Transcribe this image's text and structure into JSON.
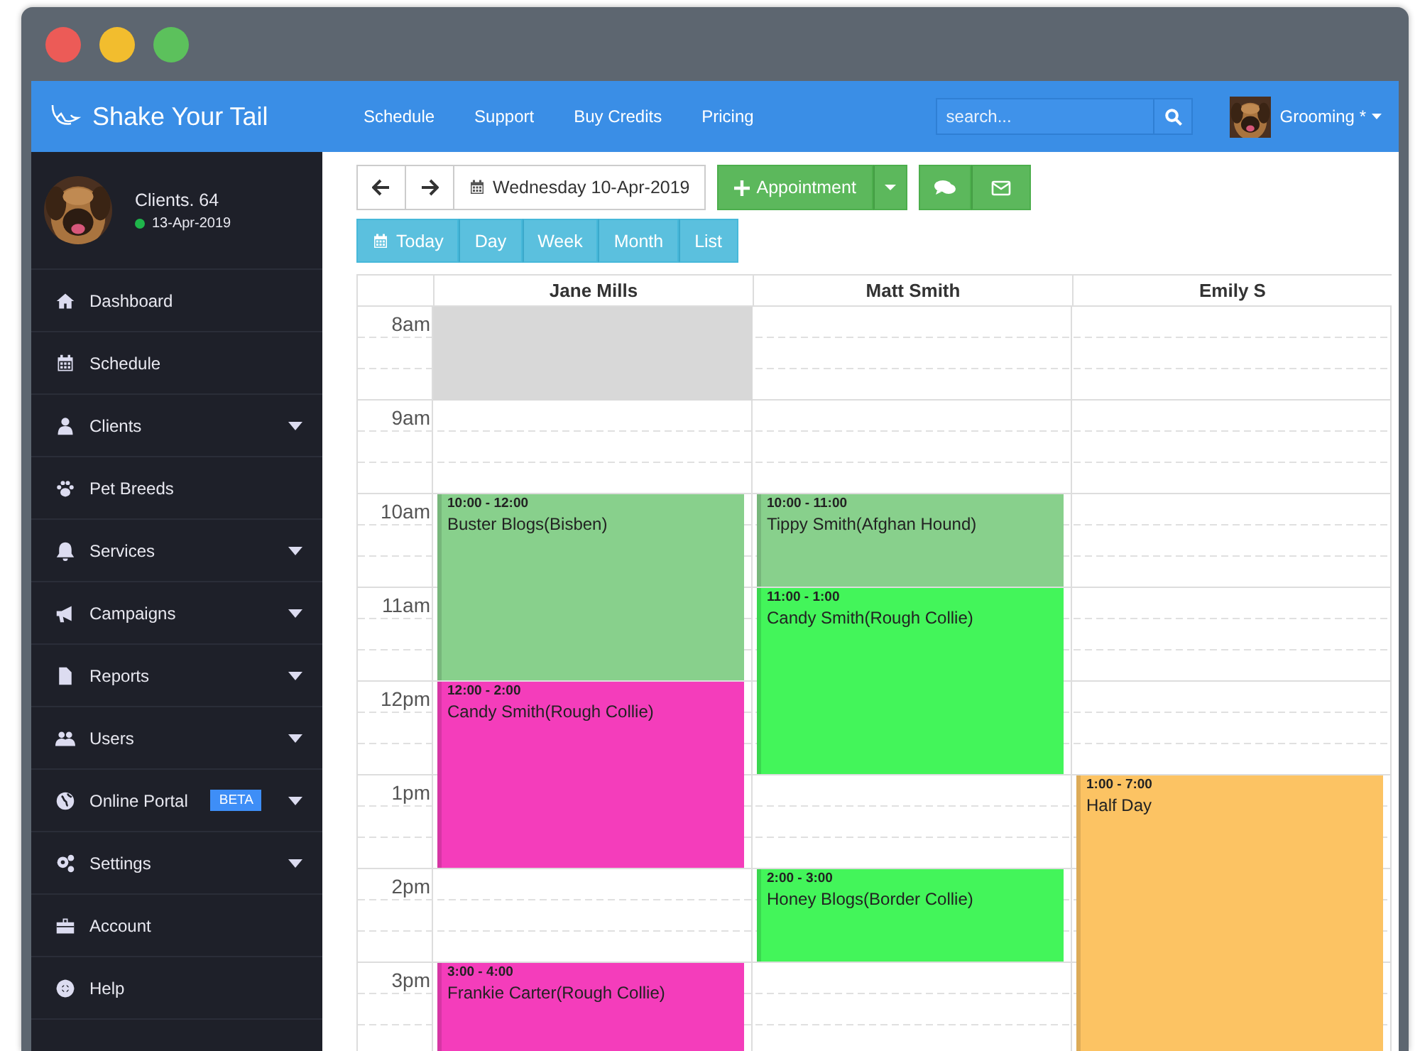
{
  "topbar": {
    "brand": "Shake Your Tail",
    "nav": [
      "Schedule",
      "Support",
      "Buy Credits",
      "Pricing"
    ],
    "search": {
      "placeholder": "search..."
    },
    "user": {
      "name": "Grooming *"
    }
  },
  "sidebar": {
    "profile": {
      "title": "Clients. 64",
      "date": "13-Apr-2019",
      "online": true
    },
    "items": [
      {
        "label": "Dashboard",
        "expandable": false
      },
      {
        "label": "Schedule",
        "expandable": false
      },
      {
        "label": "Clients",
        "expandable": true
      },
      {
        "label": "Pet Breeds",
        "expandable": false
      },
      {
        "label": "Services",
        "expandable": true
      },
      {
        "label": "Campaigns",
        "expandable": true
      },
      {
        "label": "Reports",
        "expandable": true
      },
      {
        "label": "Users",
        "expandable": true
      },
      {
        "label": "Online Portal",
        "badge": "BETA",
        "expandable": true
      },
      {
        "label": "Settings",
        "expandable": true
      },
      {
        "label": "Account",
        "expandable": false
      },
      {
        "label": "Help",
        "expandable": false
      }
    ]
  },
  "toolbar": {
    "date": "Wednesday 10-Apr-2019",
    "new_button": "Appointment",
    "views": [
      "Today",
      "Day",
      "Week",
      "Month",
      "List"
    ]
  },
  "calendar": {
    "times": [
      "8am",
      "9am",
      "10am",
      "11am",
      "12pm",
      "1pm",
      "2pm",
      "3pm"
    ],
    "columns": [
      {
        "name": "Jane Mills",
        "events": [
          {
            "kind": "unavailable"
          },
          {
            "kind": "appointment",
            "time": "10:00 - 12:00",
            "title": "Buster Blogs(Bisben)",
            "color": "#88d08c"
          },
          {
            "kind": "appointment",
            "time": "12:00 - 2:00",
            "title": "Candy Smith(Rough Collie)",
            "color": "#f43dbb"
          },
          {
            "kind": "appointment",
            "time": "3:00 - 4:00",
            "title": "Frankie Carter(Rough Collie)",
            "color": "#f43dbb"
          }
        ]
      },
      {
        "name": "Matt Smith",
        "events": [
          {
            "kind": "appointment",
            "time": "10:00 - 11:00",
            "title": "Tippy Smith(Afghan Hound)",
            "color": "#88d08c"
          },
          {
            "kind": "appointment",
            "time": "11:00 - 1:00",
            "title": "Candy Smith(Rough Collie)",
            "color": "#43f55a"
          },
          {
            "kind": "appointment",
            "time": "2:00 - 3:00",
            "title": "Honey Blogs(Border Collie)",
            "color": "#43f55a"
          }
        ]
      },
      {
        "name": "Emily S",
        "events": [
          {
            "kind": "appointment",
            "time": "1:00 - 7:00",
            "title": "Half Day",
            "color": "#fcc363"
          }
        ]
      }
    ]
  }
}
